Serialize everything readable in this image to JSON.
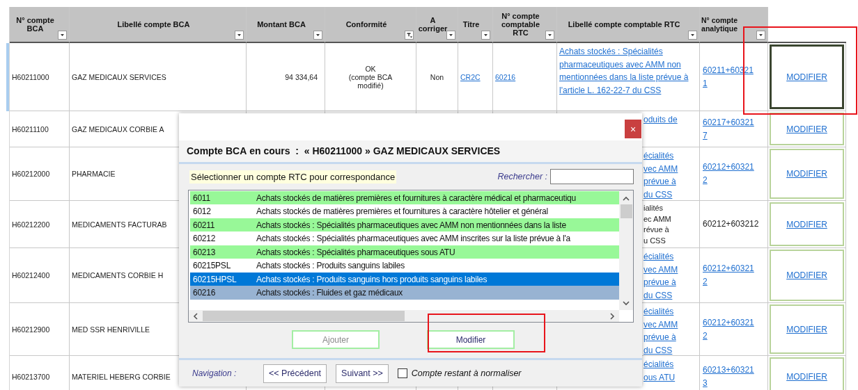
{
  "sheet": {
    "columns": [
      {
        "label": "N° compte\nBCA",
        "filtered": false
      },
      {
        "label": "Libellé compte BCA",
        "filtered": false
      },
      {
        "label": "Montant BCA",
        "filtered": false
      },
      {
        "label": "Conformité",
        "filtered": true
      },
      {
        "label": "A corriger",
        "filtered": false
      },
      {
        "label": "Titre",
        "filtered": false
      },
      {
        "label": "N° compte\ncomptable\nRTC",
        "filtered": false
      },
      {
        "label": "Libellé compte comptable RTC",
        "filtered": false
      },
      {
        "label": "N° compte\nanalytique",
        "filtered": false
      }
    ],
    "rows": [
      {
        "selected": true,
        "link": true,
        "account": "H60211000",
        "label": "GAZ MEDICAUX SERVICES",
        "amount": "94 334,64",
        "conformity": "OK\n(compte BCA\nmodifié)",
        "to_fix": "Non",
        "title": "CR2C",
        "rtc_account": "60216",
        "rtc_label": "Achats stockés : Spécialités pharmaceutiques avec AMM non mentionnées dans la liste prévue à l'article L. 162-22-7 du CSS",
        "analytic_account": "60211+60321\n1",
        "action": "MODIFIER"
      },
      {
        "selected": false,
        "link": true,
        "account": "H60211100",
        "label": "GAZ MEDICAUX CORBIE A",
        "rtc_label": "oduits de",
        "analytic_account": "60217+60321\n7",
        "action": "MODIFIER"
      },
      {
        "selected": false,
        "link": true,
        "account": "H60212000",
        "label": "PHARMACIE",
        "rtc_label": "écialités\nvec AMM\nprévue à\ndu CSS",
        "analytic_account": "60212+60321\n2",
        "action": "MODIFIER"
      },
      {
        "selected": false,
        "link": false,
        "account": "H60212200",
        "label": "MEDICAMENTS FACTURAB",
        "rtc_label": "ialités\nec AMM\nrévue à\nu CSS",
        "analytic_account": "60212+603212",
        "action": "MODIFIER"
      },
      {
        "selected": false,
        "link": true,
        "account": "H60212400",
        "label": "MEDICAMENTS CORBIE H",
        "rtc_label": "écialités\nvec AMM\nprévue à\ndu CSS",
        "analytic_account": "60212+60321\n2",
        "action": "MODIFIER"
      },
      {
        "selected": false,
        "link": true,
        "account": "H60212900",
        "label": "MED SSR HENRIVILLE",
        "rtc_label": "écialités\nvec AMM\nprévue à\ndu CSS",
        "analytic_account": "60212+60321\n2",
        "action": "MODIFIER"
      },
      {
        "selected": false,
        "link": true,
        "account": "H60213700",
        "label": "MATERIEL HEBERG CORBIE",
        "rtc_label": "écialités\nous ATU",
        "analytic_account": "60213+60321\n3",
        "action": "MODIFIER"
      }
    ]
  },
  "dialog": {
    "close_label": "×",
    "heading": "Compte BCA en cours  :  « H60211000 » GAZ MEDICAUX SERVICES",
    "prompt": "Sélectionner un compte RTC pour correspondance",
    "search_label": "Rechercher :",
    "entries": [
      {
        "code": "6011",
        "label": "Achats stockés de matières premières et fournitures à caractère médical et pharmaceutiqu",
        "color": "#98f898",
        "selected": false
      },
      {
        "code": "6012",
        "label": "Achats stockés de matières premières et fournitures à caractère hôtelier et général",
        "color": "#ffffff",
        "selected": false
      },
      {
        "code": "60211",
        "label": "Achats stockés : Spécialités pharmaceutiques avec AMM non mentionnées dans la liste",
        "color": "#98f898",
        "selected": false
      },
      {
        "code": "60212",
        "label": "Achats stockés : Spécialités pharmaceutiques avec AMM inscrites sur la liste prévue à l'a",
        "color": "#ffffff",
        "selected": false
      },
      {
        "code": "60213",
        "label": "Achats stockés : Spécialités pharmaceutiques sous ATU",
        "color": "#98f898",
        "selected": false
      },
      {
        "code": "60215PSL",
        "label": "Achats stockés : Produits sanguins labiles",
        "color": "#ffffff",
        "selected": false
      },
      {
        "code": "60215HPSL",
        "label": "Achats stockés : Produits sanguins hors produits sanguins labiles",
        "selected": true
      },
      {
        "code": "60216",
        "label": "Achats stockés : Fluides et gaz médicaux",
        "color": "#98b3d2",
        "selected": false
      }
    ],
    "buttons": [
      {
        "label": "Ajouter",
        "disabled": true
      },
      {
        "label": "Modifier",
        "disabled": false
      }
    ],
    "navigation_label": "Navigation :",
    "nav_buttons": [
      "<< Précédent",
      "Suivant >>"
    ],
    "checkbox": {
      "label": "Compte restant à normaliser",
      "checked": false
    }
  }
}
